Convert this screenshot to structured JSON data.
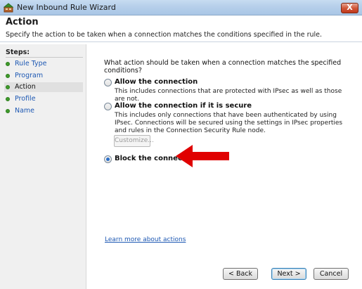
{
  "window": {
    "title": "New Inbound Rule Wizard",
    "close_glyph": "X"
  },
  "header": {
    "title": "Action",
    "description": "Specify the action to be taken when a connection matches the conditions specified in the rule."
  },
  "steps": {
    "heading": "Steps:",
    "items": [
      {
        "label": "Rule Type"
      },
      {
        "label": "Program"
      },
      {
        "label": "Action"
      },
      {
        "label": "Profile"
      },
      {
        "label": "Name"
      }
    ],
    "current": "Action"
  },
  "main": {
    "question": "What action should be taken when a connection matches the specified conditions?",
    "options": [
      {
        "label": "Allow the connection",
        "description": "This includes connections that are protected with IPsec as well as those are not.",
        "selected": false
      },
      {
        "label": "Allow the connection if it is secure",
        "description": "This includes only connections that have been authenticated by using IPsec.  Connections will be secured using the settings in IPsec properties and rules in the Connection Security Rule node.",
        "selected": false
      },
      {
        "label": "Block the connection",
        "description": "",
        "selected": true
      }
    ],
    "customize_label": "Customize...",
    "learn_more": "Learn more about actions"
  },
  "footer": {
    "back_label": "< Back",
    "next_label": "Next >",
    "cancel_label": "Cancel"
  },
  "colors": {
    "link": "#1d58b3",
    "step_bullet": "#3f9b2b",
    "annotation_arrow": "#e00000"
  }
}
